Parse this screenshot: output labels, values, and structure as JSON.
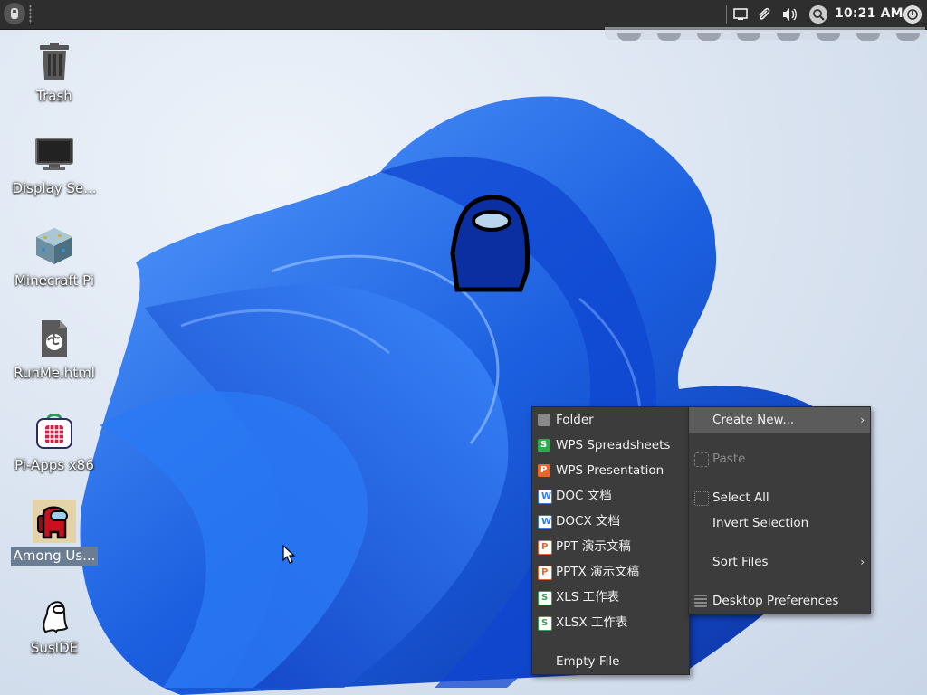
{
  "panel": {
    "clock": "10:21 AM",
    "tray_icons": [
      "display-icon",
      "paperclip-icon",
      "volume-icon",
      "search-icon",
      "power-icon"
    ]
  },
  "desktop": {
    "icons": [
      {
        "label": "Trash",
        "icon": "trash-icon"
      },
      {
        "label": "Display Se...",
        "icon": "monitor-icon"
      },
      {
        "label": "Minecraft Pi",
        "icon": "minecraft-icon"
      },
      {
        "label": "RunMe.html",
        "icon": "html-file-icon"
      },
      {
        "label": "Pi-Apps x86",
        "icon": "pi-apps-icon"
      },
      {
        "label": "Among Us...",
        "icon": "among-us-icon"
      },
      {
        "label": "SusIDE",
        "icon": "suside-icon"
      }
    ]
  },
  "context_menu": {
    "items": [
      {
        "label": "Create New...",
        "has_submenu": true
      },
      {
        "label": "Paste",
        "disabled": true
      },
      {
        "label": "Select All"
      },
      {
        "label": "Invert Selection"
      },
      {
        "label": "Sort Files",
        "has_submenu": true
      },
      {
        "label": "Desktop Preferences"
      }
    ]
  },
  "create_new_menu": {
    "items": [
      {
        "label": "Folder",
        "icon": "folder-icon",
        "color": "#8a8a8a"
      },
      {
        "label": "WPS Spreadsheets",
        "icon": "wps-spreadsheets-icon",
        "color": "#2fa84f"
      },
      {
        "label": "WPS Presentation",
        "icon": "wps-presentation-icon",
        "color": "#e8672a"
      },
      {
        "label": "DOC 文档",
        "icon": "doc-icon",
        "color": "#3b7bd9"
      },
      {
        "label": "DOCX 文档",
        "icon": "docx-icon",
        "color": "#3b7bd9"
      },
      {
        "label": "PPT 演示文稿",
        "icon": "ppt-icon",
        "color": "#e8672a"
      },
      {
        "label": "PPTX 演示文稿",
        "icon": "pptx-icon",
        "color": "#e8672a"
      },
      {
        "label": "XLS 工作表",
        "icon": "xls-icon",
        "color": "#2fa84f"
      },
      {
        "label": "XLSX 工作表",
        "icon": "xlsx-icon",
        "color": "#2fa84f"
      },
      {
        "label": "Empty File",
        "icon": "none"
      }
    ]
  }
}
